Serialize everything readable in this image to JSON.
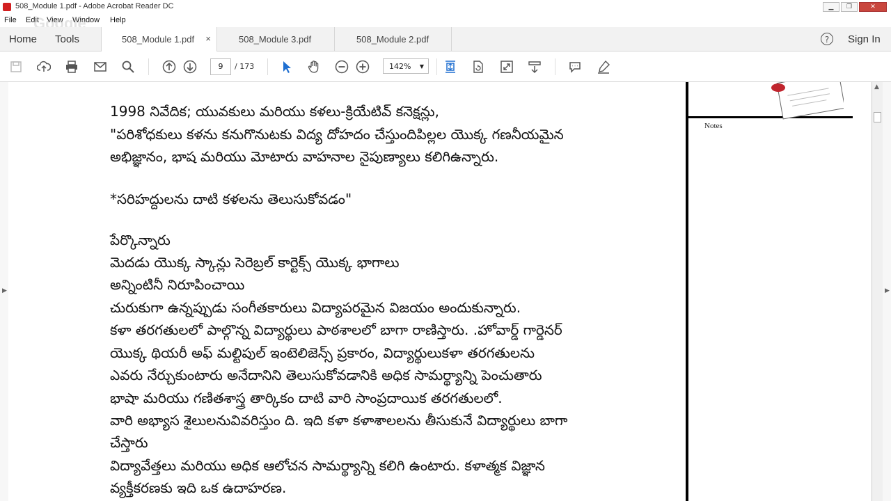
{
  "window": {
    "title": "508_Module 1.pdf - Adobe Acrobat Reader DC"
  },
  "menu": {
    "file": "File",
    "edit": "Edit",
    "view": "View",
    "window": "Window",
    "help": "Help"
  },
  "watermark": "Google",
  "nav": {
    "home": "Home",
    "tools": "Tools",
    "sign_in": "Sign In",
    "help_glyph": "?"
  },
  "tabs": [
    {
      "label": "508_Module 1.pdf",
      "active": true,
      "close": "×"
    },
    {
      "label": "508_Module 3.pdf",
      "active": false
    },
    {
      "label": "508_Module 2.pdf",
      "active": false
    }
  ],
  "toolbar": {
    "page_current": "9",
    "page_total": "/ 173",
    "zoom": "142%",
    "icons": [
      "save-icon",
      "upload-icon",
      "print-icon",
      "email-icon",
      "search-icon",
      "prev-page-icon",
      "next-page-icon",
      "select-cursor-icon",
      "hand-tool-icon",
      "zoom-out-icon",
      "zoom-in-icon",
      "fit-page-icon",
      "rotate-icon",
      "fullscreen-icon",
      "scroll-mode-icon",
      "comment-icon",
      "highlight-pen-icon"
    ]
  },
  "document": {
    "lines": [
      "1998 నివేదిక; యువకులు మరియు కళలు-క్రియేటివ్ కనెక్షన్లు,",
      "\"పరిశోధకులు కళను కనుగొనుటకు విద్య దోహదం చేస్తుందిపిల్లల యొక్క గణనీయమైన",
      "అభిజ్ఞానం, భాష మరియు మోటారు వాహనాల నైపుణ్యాలు కలిగిఉన్నారు.",
      "",
      "*సరిహద్దులను దాటి కళలను తెలుసుకోవడం\"",
      "",
      "పేర్కొన్నారు",
      "మెదడు యొక్క స్కాన్లు సెరెబ్రల్ కార్టెక్స్ యొక్క భాగాలు",
      " అన్నింటినీ నిరూపించాయి",
      "చురుకుగా ఉన్నప్పుడు సంగీతకారులు విద్యాపరమైన విజయం అందుకున్నారు.",
      "కళా తరగతులలో పాల్గొన్న విద్యార్థులు పాఠశాలలో బాగా రాణిస్తారు. .హోవార్డ్ గార్డెనర్",
      "యొక్క థియరీ అఫ్ మల్టిపుల్ ఇంటెలిజెన్స్ ప్రకారం, విద్యార్థులుకళా తరగతులను",
      "ఎవరు నేర్చుకుంటారు అనేదానిని తెలుసుకోవడానికి అధిక సామర్థ్యాన్ని పెంచుతారు",
      "భాషా మరియు గణితశాస్త్ర తార్కికం దాటి వారి సాంప్రదాయిక తరగతులలో.",
      " వారి అభ్యాస శైలులనువివరిస్తుం ది. ఇది కళా కళాశాలలను తీసుకునే విద్యార్థులు బాగా",
      "చేస్తారు",
      "విద్యావేత్తలు మరియు అధిక ఆలోచన సామర్థ్యాన్ని కలిగి ఉంటారు. కళాత్మక విజ్ఞాన",
      "వ్యక్తీకరణకు ఇది ఒక ఉదాహరణ."
    ],
    "margin_label": "Notes"
  }
}
